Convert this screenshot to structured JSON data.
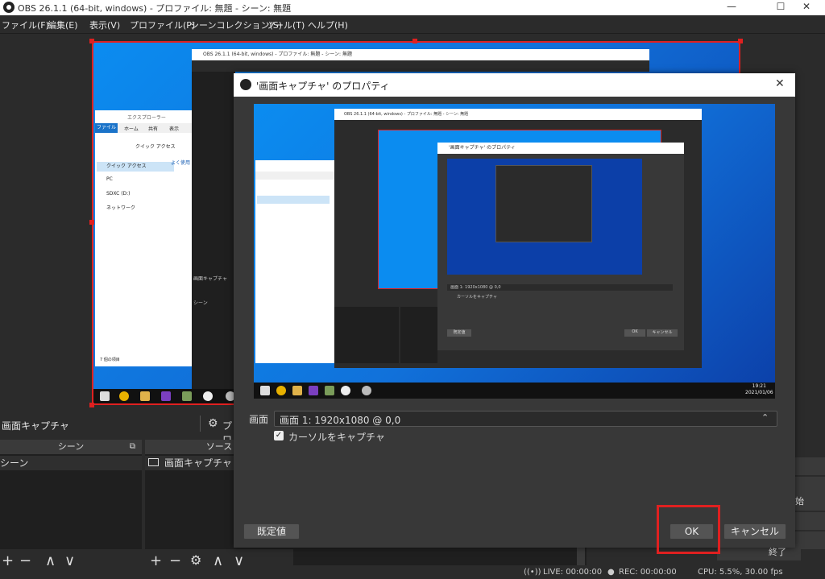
{
  "window": {
    "title": "OBS 26.1.1 (64-bit, windows) - プロファイル: 無題 - シーン: 無題",
    "minimize": "—",
    "maximize": "☐",
    "close": "✕"
  },
  "menu": [
    "ファイル(F)",
    "編集(E)",
    "表示(V)",
    "プロファイル(P)",
    "シーンコレクション(S)",
    "ツール(T)",
    "ヘルプ(H)"
  ],
  "preview": {
    "inner_window_title": "OBS 26.1.1 (64-bit, windows) - プロファイル: 無題 - シーン: 無題",
    "explorer": {
      "title": "エクスプローラー",
      "tabs": [
        "ファイル",
        "ホーム",
        "共有",
        "表示"
      ],
      "address": "クイック アクセス",
      "nav": [
        "クイック アクセス",
        "PC",
        "SDXC (D:)",
        "ネットワーク"
      ],
      "frequent": "よく使用",
      "items_count": "7 個の項目"
    },
    "inner_labels": {
      "capture": "画面キャプチャ",
      "scene": "シーン",
      "scene_item": "シーン"
    }
  },
  "scene_bar": {
    "source_name": "画面キャプチャ",
    "properties_label": "プロ"
  },
  "scenes_dock": {
    "header": "シーン",
    "items": [
      "シーン"
    ]
  },
  "sources_dock": {
    "header": "ソース",
    "items": [
      "画面キャプチャ"
    ]
  },
  "controls": {
    "start": "始",
    "exit": "終了"
  },
  "dialog": {
    "title": "'画面キャプチャ' のプロパティ",
    "display_label": "画面",
    "display_value": "画面 1: 1920x1080 @ 0,0",
    "capture_cursor_label": "カーソルをキャプチャ",
    "capture_cursor_checked": true,
    "defaults_button": "既定値",
    "ok_button": "OK",
    "cancel_button": "キャンセル",
    "nested_preview": {
      "inner_title": "OBS 26.1.1 (64-bit, windows) - プロファイル: 無題 - シーン: 無題",
      "inner_dialog_title": "'画面キャプチャ' のプロパティ",
      "inner_display_value": "画面 1: 1920x1080 @ 0,0",
      "inner_cursor_label": "カーソルをキャプチャ",
      "inner_defaults": "既定値",
      "inner_ok": "OK",
      "inner_cancel": "キャンセル",
      "clock_time": "19:21",
      "clock_date": "2021/01/06"
    }
  },
  "status": {
    "live": "LIVE: 00:00:00",
    "rec": "REC: 00:00:00",
    "cpu": "CPU: 5.5%, 30.00 fps"
  }
}
